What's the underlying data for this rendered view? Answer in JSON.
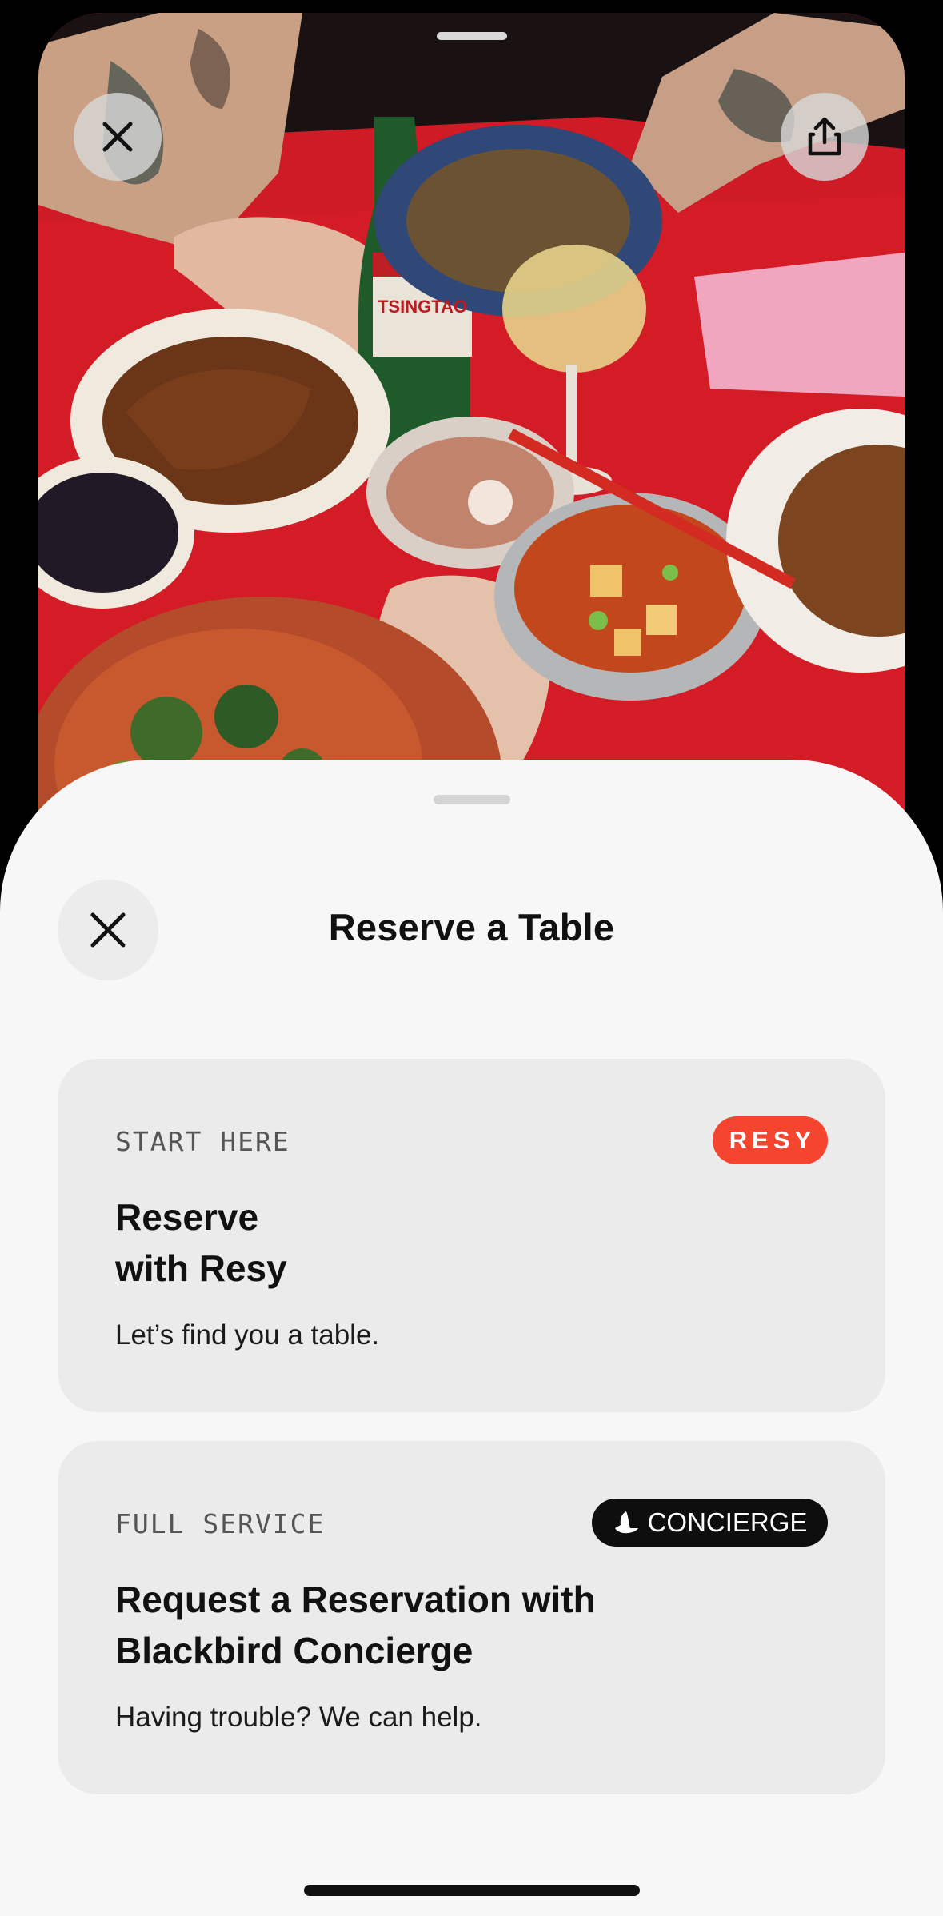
{
  "photo": {
    "close_icon": "close-icon",
    "share_icon": "share-icon",
    "bottle_text": "TSINGTAO"
  },
  "sheet": {
    "title": "Reserve a Table",
    "close_icon": "close-icon"
  },
  "options": [
    {
      "eyebrow": "START HERE",
      "badge": "RESY",
      "title": "Reserve\nwith Resy",
      "subtitle": "Let’s find you a table."
    },
    {
      "eyebrow": "FULL SERVICE",
      "badge": "CONCIERGE",
      "title": "Request a Reservation with Blackbird Concierge",
      "subtitle": "Having trouble? We can help."
    }
  ],
  "colors": {
    "resy_badge": "#f5452e",
    "concierge_badge": "#0e0e0e",
    "sheet_bg": "#f7f7f7",
    "card_bg": "#ebebeb"
  }
}
